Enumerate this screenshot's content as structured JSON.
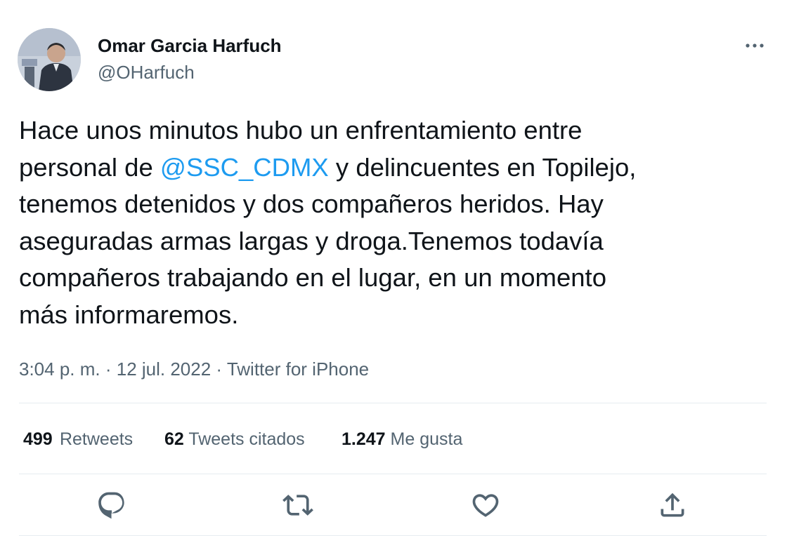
{
  "author": {
    "display_name": "Omar Garcia Harfuch",
    "handle": "@OHarfuch"
  },
  "tweet": {
    "text_before": "Hace unos minutos hubo un enfrentamiento entre\npersonal de ",
    "mention": "@SSC_CDMX",
    "text_after": " y delincuentes en Topilejo,\ntenemos detenidos y dos compañeros heridos. Hay\naseguradas armas largas y droga.Tenemos todavía\ncompañeros trabajando en el lugar, en un momento\nmás informaremos."
  },
  "meta": {
    "time": "3:04 p. m.",
    "separator": " · ",
    "date": "12 jul. 2022",
    "source": "Twitter for iPhone"
  },
  "stats": {
    "retweets_count": "499",
    "retweets_label": "Retweets",
    "quotes_count": "62",
    "quotes_label": "Tweets citados",
    "likes_count": "1.247",
    "likes_label": "Me gusta"
  },
  "colors": {
    "text": "#0f1419",
    "secondary": "#536471",
    "link": "#1d9bf0",
    "divider": "#e6ecf0"
  },
  "icons": [
    "more-horizontal-icon",
    "reply-icon",
    "retweet-icon",
    "like-icon",
    "share-icon"
  ]
}
